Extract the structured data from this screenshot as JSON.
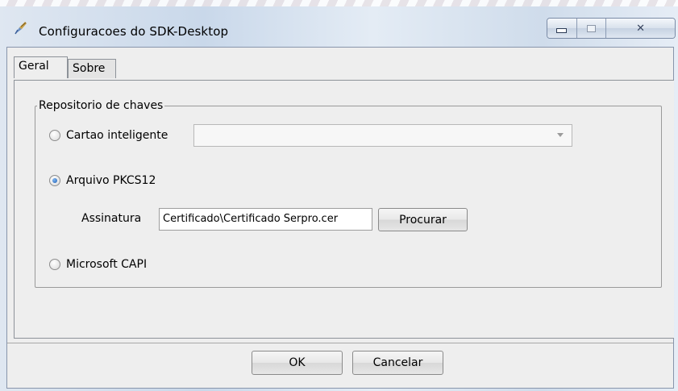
{
  "window": {
    "title": "Configuracoes do SDK-Desktop",
    "icon": "feather-tool-icon",
    "close_glyph": "✕"
  },
  "tabs": [
    {
      "label": "Geral",
      "active": true
    },
    {
      "label": "Sobre",
      "active": false
    }
  ],
  "group": {
    "legend": "Repositorio de chaves",
    "options": [
      {
        "label": "Cartao inteligente",
        "checked": false
      },
      {
        "label": "Arquivo PKCS12",
        "checked": true
      },
      {
        "label": "Microsoft CAPI",
        "checked": false
      }
    ],
    "smartcard_select": {
      "value": ""
    },
    "signature": {
      "label": "Assinatura",
      "value": "Certificado\\Certificado Serpro.cer",
      "browse_label": "Procurar"
    }
  },
  "footer": {
    "ok_label": "OK",
    "cancel_label": "Cancelar"
  }
}
